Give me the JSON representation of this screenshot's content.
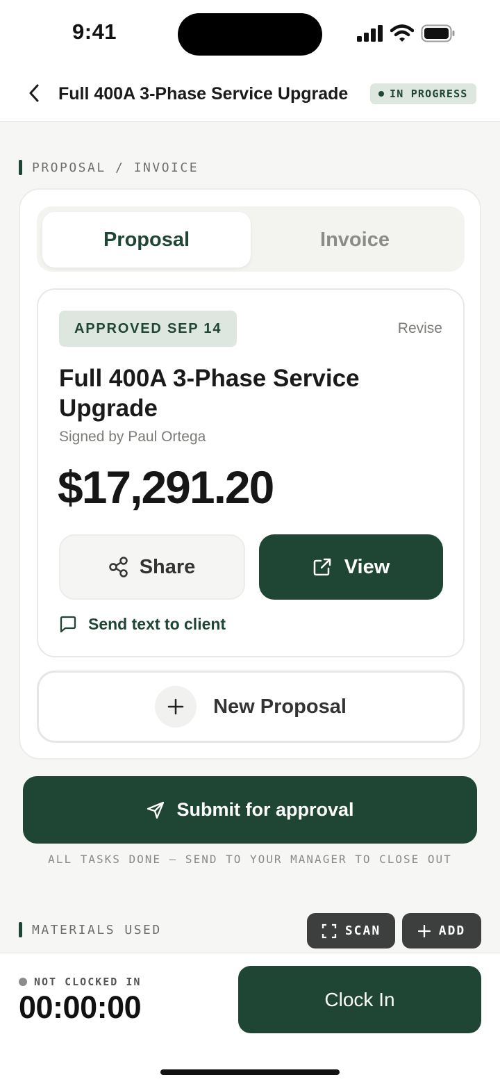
{
  "status_bar": {
    "time": "9:41"
  },
  "header": {
    "title": "Full 400A 3-Phase Service Upgrade",
    "status_badge": "IN PROGRESS"
  },
  "proposal_section": {
    "label": "PROPOSAL / INVOICE",
    "tabs": [
      {
        "label": "Proposal",
        "active": true
      },
      {
        "label": "Invoice",
        "active": false
      }
    ],
    "card": {
      "approved_badge": "APPROVED SEP 14",
      "revise_label": "Revise",
      "title": "Full 400A 3-Phase Service Upgrade",
      "signed_by": "Signed by Paul Ortega",
      "amount": "$17,291.20",
      "share_label": "Share",
      "view_label": "View",
      "send_text_label": "Send text to client"
    },
    "new_proposal_label": "New Proposal"
  },
  "submit": {
    "label": "Submit for approval",
    "hint": "ALL TASKS DONE — SEND TO YOUR MANAGER TO CLOSE OUT"
  },
  "materials": {
    "label": "MATERIALS USED",
    "scan_label": "SCAN",
    "add_label": "ADD"
  },
  "clock": {
    "status": "NOT CLOCKED IN",
    "time": "00:00:00",
    "button_label": "Clock In"
  },
  "colors": {
    "accent": "#1f4535",
    "badge_bg": "#dde6df",
    "background": "#f6f6f5"
  },
  "icons": [
    "back-chevron-icon",
    "share-icon",
    "external-link-icon",
    "message-icon",
    "plus-icon",
    "send-icon",
    "scan-icon",
    "signal-icon",
    "wifi-icon",
    "battery-icon"
  ]
}
